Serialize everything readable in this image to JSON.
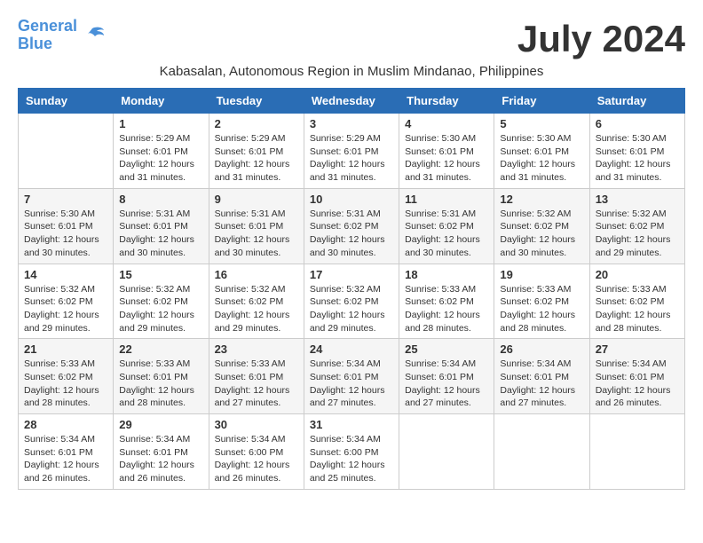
{
  "logo": {
    "line1": "General",
    "line2": "Blue"
  },
  "title": "July 2024",
  "location": "Kabasalan, Autonomous Region in Muslim Mindanao, Philippines",
  "days_of_week": [
    "Sunday",
    "Monday",
    "Tuesday",
    "Wednesday",
    "Thursday",
    "Friday",
    "Saturday"
  ],
  "weeks": [
    [
      {
        "day": "",
        "info": ""
      },
      {
        "day": "1",
        "info": "Sunrise: 5:29 AM\nSunset: 6:01 PM\nDaylight: 12 hours\nand 31 minutes."
      },
      {
        "day": "2",
        "info": "Sunrise: 5:29 AM\nSunset: 6:01 PM\nDaylight: 12 hours\nand 31 minutes."
      },
      {
        "day": "3",
        "info": "Sunrise: 5:29 AM\nSunset: 6:01 PM\nDaylight: 12 hours\nand 31 minutes."
      },
      {
        "day": "4",
        "info": "Sunrise: 5:30 AM\nSunset: 6:01 PM\nDaylight: 12 hours\nand 31 minutes."
      },
      {
        "day": "5",
        "info": "Sunrise: 5:30 AM\nSunset: 6:01 PM\nDaylight: 12 hours\nand 31 minutes."
      },
      {
        "day": "6",
        "info": "Sunrise: 5:30 AM\nSunset: 6:01 PM\nDaylight: 12 hours\nand 31 minutes."
      }
    ],
    [
      {
        "day": "7",
        "info": "Sunrise: 5:30 AM\nSunset: 6:01 PM\nDaylight: 12 hours\nand 30 minutes."
      },
      {
        "day": "8",
        "info": "Sunrise: 5:31 AM\nSunset: 6:01 PM\nDaylight: 12 hours\nand 30 minutes."
      },
      {
        "day": "9",
        "info": "Sunrise: 5:31 AM\nSunset: 6:01 PM\nDaylight: 12 hours\nand 30 minutes."
      },
      {
        "day": "10",
        "info": "Sunrise: 5:31 AM\nSunset: 6:02 PM\nDaylight: 12 hours\nand 30 minutes."
      },
      {
        "day": "11",
        "info": "Sunrise: 5:31 AM\nSunset: 6:02 PM\nDaylight: 12 hours\nand 30 minutes."
      },
      {
        "day": "12",
        "info": "Sunrise: 5:32 AM\nSunset: 6:02 PM\nDaylight: 12 hours\nand 30 minutes."
      },
      {
        "day": "13",
        "info": "Sunrise: 5:32 AM\nSunset: 6:02 PM\nDaylight: 12 hours\nand 29 minutes."
      }
    ],
    [
      {
        "day": "14",
        "info": "Sunrise: 5:32 AM\nSunset: 6:02 PM\nDaylight: 12 hours\nand 29 minutes."
      },
      {
        "day": "15",
        "info": "Sunrise: 5:32 AM\nSunset: 6:02 PM\nDaylight: 12 hours\nand 29 minutes."
      },
      {
        "day": "16",
        "info": "Sunrise: 5:32 AM\nSunset: 6:02 PM\nDaylight: 12 hours\nand 29 minutes."
      },
      {
        "day": "17",
        "info": "Sunrise: 5:32 AM\nSunset: 6:02 PM\nDaylight: 12 hours\nand 29 minutes."
      },
      {
        "day": "18",
        "info": "Sunrise: 5:33 AM\nSunset: 6:02 PM\nDaylight: 12 hours\nand 28 minutes."
      },
      {
        "day": "19",
        "info": "Sunrise: 5:33 AM\nSunset: 6:02 PM\nDaylight: 12 hours\nand 28 minutes."
      },
      {
        "day": "20",
        "info": "Sunrise: 5:33 AM\nSunset: 6:02 PM\nDaylight: 12 hours\nand 28 minutes."
      }
    ],
    [
      {
        "day": "21",
        "info": "Sunrise: 5:33 AM\nSunset: 6:02 PM\nDaylight: 12 hours\nand 28 minutes."
      },
      {
        "day": "22",
        "info": "Sunrise: 5:33 AM\nSunset: 6:01 PM\nDaylight: 12 hours\nand 28 minutes."
      },
      {
        "day": "23",
        "info": "Sunrise: 5:33 AM\nSunset: 6:01 PM\nDaylight: 12 hours\nand 27 minutes."
      },
      {
        "day": "24",
        "info": "Sunrise: 5:34 AM\nSunset: 6:01 PM\nDaylight: 12 hours\nand 27 minutes."
      },
      {
        "day": "25",
        "info": "Sunrise: 5:34 AM\nSunset: 6:01 PM\nDaylight: 12 hours\nand 27 minutes."
      },
      {
        "day": "26",
        "info": "Sunrise: 5:34 AM\nSunset: 6:01 PM\nDaylight: 12 hours\nand 27 minutes."
      },
      {
        "day": "27",
        "info": "Sunrise: 5:34 AM\nSunset: 6:01 PM\nDaylight: 12 hours\nand 26 minutes."
      }
    ],
    [
      {
        "day": "28",
        "info": "Sunrise: 5:34 AM\nSunset: 6:01 PM\nDaylight: 12 hours\nand 26 minutes."
      },
      {
        "day": "29",
        "info": "Sunrise: 5:34 AM\nSunset: 6:01 PM\nDaylight: 12 hours\nand 26 minutes."
      },
      {
        "day": "30",
        "info": "Sunrise: 5:34 AM\nSunset: 6:00 PM\nDaylight: 12 hours\nand 26 minutes."
      },
      {
        "day": "31",
        "info": "Sunrise: 5:34 AM\nSunset: 6:00 PM\nDaylight: 12 hours\nand 25 minutes."
      },
      {
        "day": "",
        "info": ""
      },
      {
        "day": "",
        "info": ""
      },
      {
        "day": "",
        "info": ""
      }
    ]
  ]
}
